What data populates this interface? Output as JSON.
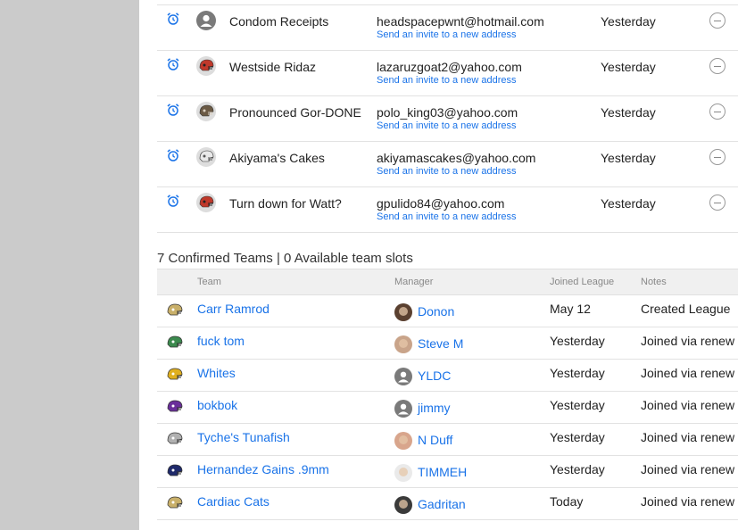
{
  "pending_invites": [
    {
      "team": "Condom Receipts",
      "email": "headspacepwnt@hotmail.com",
      "invite_link": "Send an invite to a new address",
      "date": "Yesterday",
      "avatar": "generic-user-icon"
    },
    {
      "team": "Westside Ridaz",
      "email": "lazaruzgoat2@yahoo.com",
      "invite_link": "Send an invite to a new address",
      "date": "Yesterday",
      "avatar": "red-helmet-icon"
    },
    {
      "team": "Pronounced Gor-DONE",
      "email": "polo_king03@yahoo.com",
      "invite_link": "Send an invite to a new address",
      "date": "Yesterday",
      "avatar": "camo-helmet-icon"
    },
    {
      "team": "Akiyama's Cakes",
      "email": "akiyamascakes@yahoo.com",
      "invite_link": "Send an invite to a new address",
      "date": "Yesterday",
      "avatar": "white-helmet-icon"
    },
    {
      "team": "Turn down for Watt?",
      "email": "gpulido84@yahoo.com",
      "invite_link": "Send an invite to a new address",
      "date": "Yesterday",
      "avatar": "red-helmet-icon"
    }
  ],
  "confirmed": {
    "title": "7 Confirmed Teams | 0 Available team slots",
    "headers": {
      "team": "Team",
      "manager": "Manager",
      "joined": "Joined League",
      "notes": "Notes"
    },
    "rows": [
      {
        "team": "Carr Ramrod",
        "manager": "Donon",
        "joined": "May 12",
        "notes": "Created League",
        "helmet": "#c9b06a"
      },
      {
        "team": "fuck tom",
        "manager": "Steve M",
        "joined": "Yesterday",
        "notes": "Joined via renew",
        "helmet": "#3c8a4e"
      },
      {
        "team": "Whites",
        "manager": "YLDC",
        "joined": "Yesterday",
        "notes": "Joined via renew",
        "helmet": "#e0b020"
      },
      {
        "team": "bokbok",
        "manager": "jimmy",
        "joined": "Yesterday",
        "notes": "Joined via renew",
        "helmet": "#6a2f9a"
      },
      {
        "team": "Tyche's Tunafish",
        "manager": "N Duff",
        "joined": "Yesterday",
        "notes": "Joined via renew",
        "helmet": "#b0b0b0"
      },
      {
        "team": "Hernandez Gains .9mm",
        "manager": "TIMMEH",
        "joined": "Yesterday",
        "notes": "Joined via renew",
        "helmet": "#1f2a6b"
      },
      {
        "team": "Cardiac Cats",
        "manager": "Gadritan",
        "joined": "Today",
        "notes": "Joined via renew",
        "helmet": "#c9b06a"
      }
    ]
  },
  "colors": {
    "link": "#1a73e8",
    "alarm": "#1a73e8",
    "gutter": "#cbcbcb"
  }
}
